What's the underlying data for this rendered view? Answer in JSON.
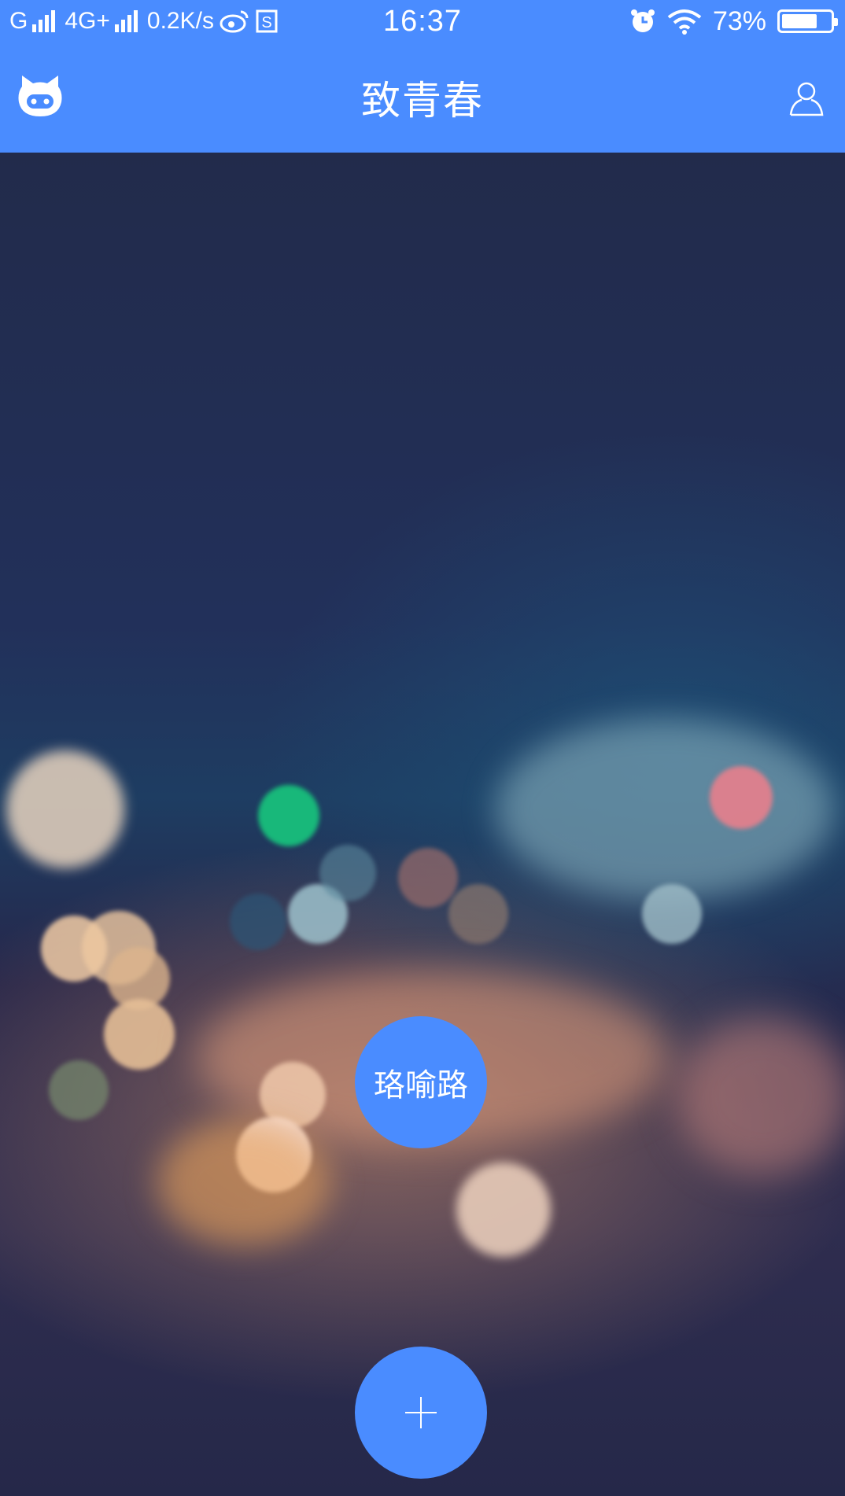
{
  "status_bar": {
    "carrier1": "G",
    "carrier2": "4G+",
    "speed": "0.2K/s",
    "time": "16:37",
    "battery": "73%",
    "battery_level": 0.73,
    "icons": [
      "signal-icon",
      "weibo-icon",
      "s-app-icon",
      "alarm-icon",
      "wifi-icon",
      "battery-icon"
    ]
  },
  "app_bar": {
    "title": "致青春",
    "left_icon": "cat-logo-icon",
    "right_icon": "user-profile-icon"
  },
  "main": {
    "name_button_label": "珞喻路",
    "add_button_icon": "plus-icon"
  },
  "colors": {
    "accent": "#4a8cff",
    "background_dark": "#232a4a"
  }
}
